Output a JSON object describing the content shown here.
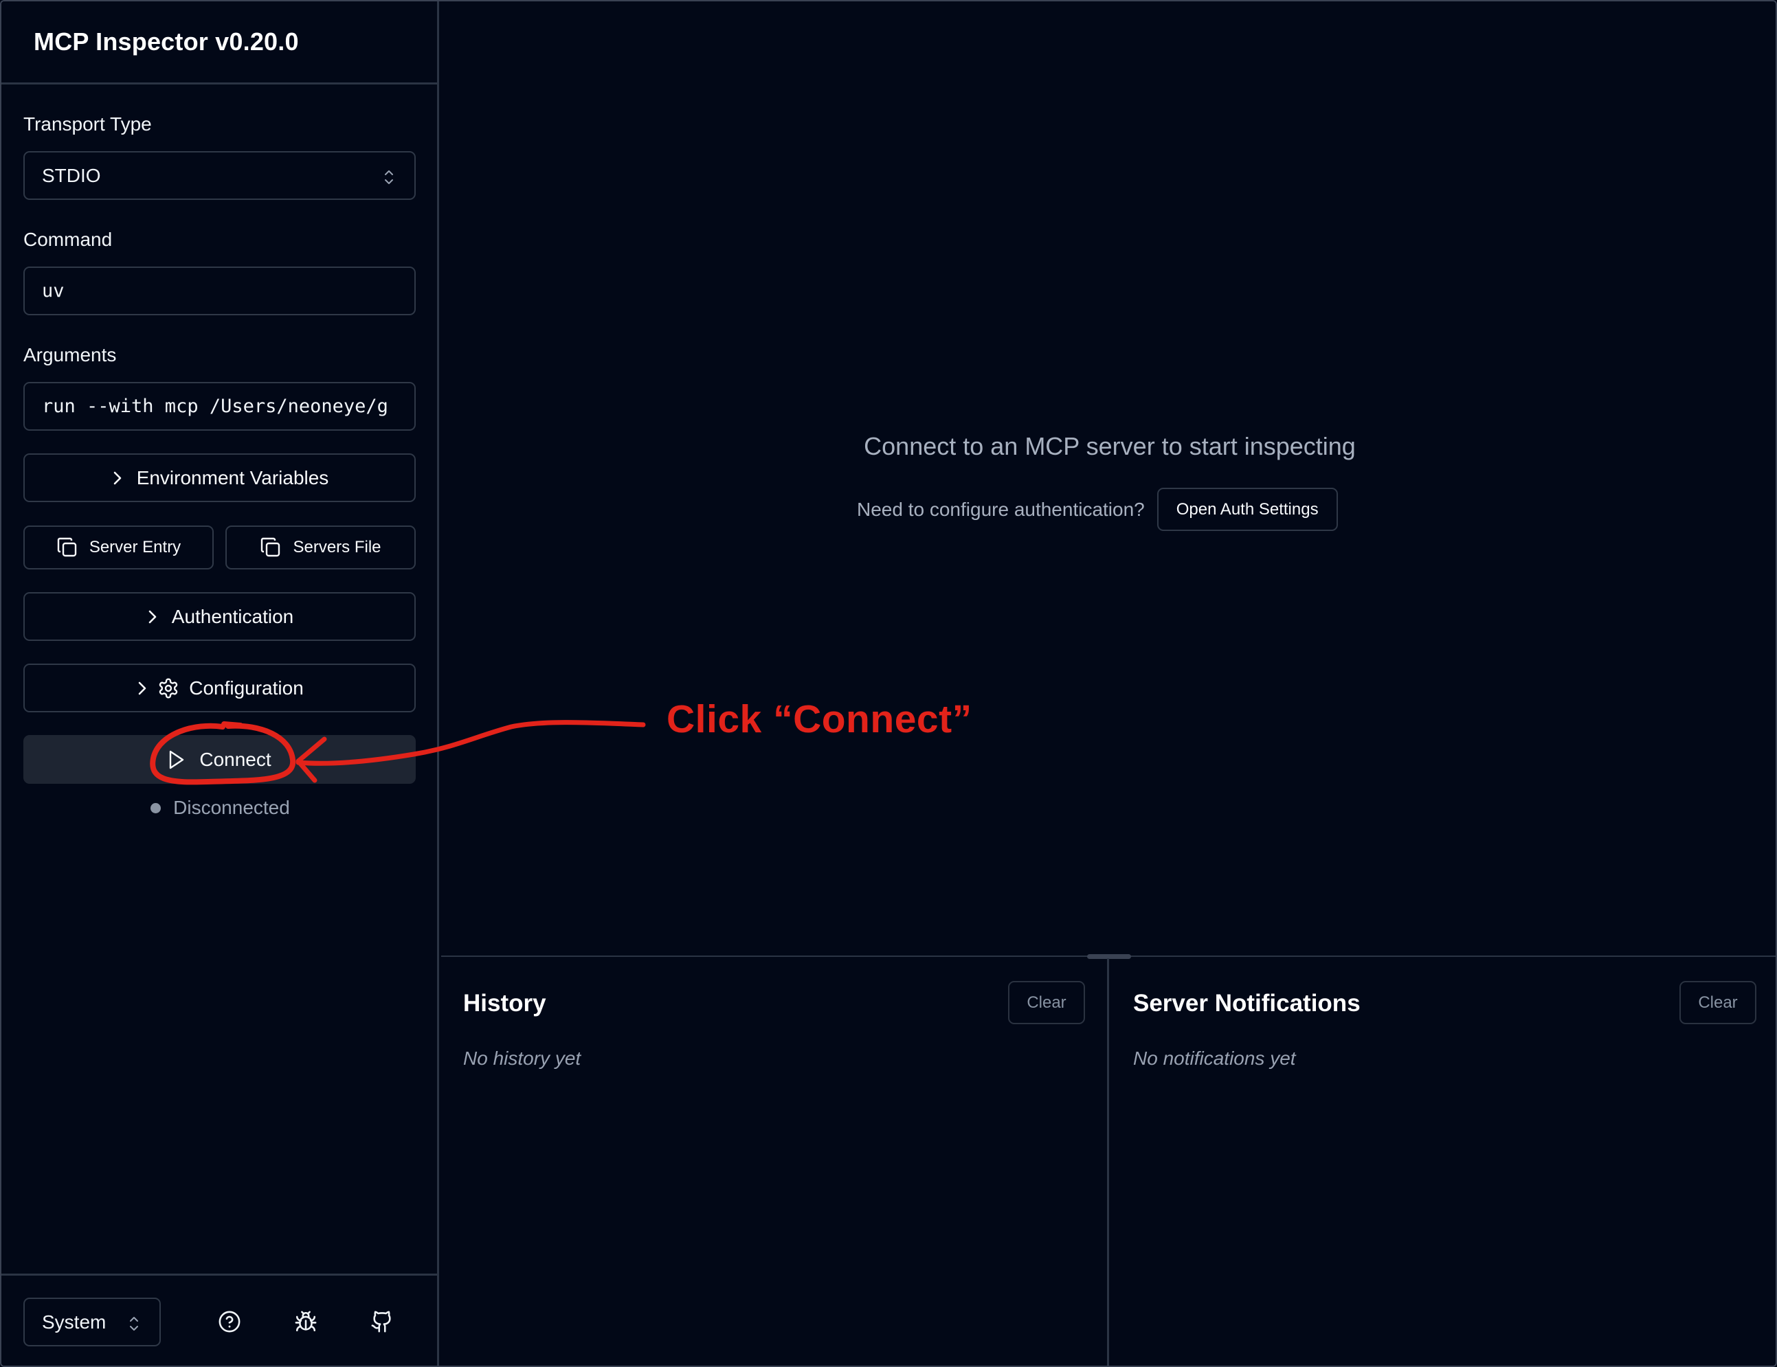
{
  "app": {
    "title": "MCP Inspector v0.20.0"
  },
  "sidebar": {
    "transport_label": "Transport Type",
    "transport_value": "STDIO",
    "command_label": "Command",
    "command_value": "uv",
    "arguments_label": "Arguments",
    "arguments_value": "run --with mcp /Users/neoneye/g",
    "env_vars_label": "Environment Variables",
    "server_entry_label": "Server Entry",
    "servers_file_label": "Servers File",
    "authentication_label": "Authentication",
    "configuration_label": "Configuration",
    "connect_label": "Connect",
    "status_text": "Disconnected",
    "theme_value": "System"
  },
  "main": {
    "empty_title": "Connect to an MCP server to start inspecting",
    "auth_question": "Need to configure authentication?",
    "auth_button": "Open Auth Settings"
  },
  "history": {
    "title": "History",
    "clear_label": "Clear",
    "empty_text": "No history yet"
  },
  "notifications": {
    "title": "Server Notifications",
    "clear_label": "Clear",
    "empty_text": "No notifications yet"
  },
  "annotation": {
    "text": "Click “Connect”",
    "color": "#e2231a"
  },
  "icons": {
    "env_vars": "chevron-right-icon",
    "server_entry": "copy-icon",
    "servers_file": "copy-icon",
    "authentication": "chevron-right-icon",
    "configuration": [
      "chevron-right-icon",
      "gear-icon"
    ],
    "connect": "play-icon",
    "footer": [
      "help-circle-icon",
      "bug-icon",
      "github-icon"
    ]
  },
  "colors": {
    "background": "#020817",
    "border": "#2f3847",
    "connect_button": "#1e2532",
    "status_dot": "#8a94a3"
  }
}
